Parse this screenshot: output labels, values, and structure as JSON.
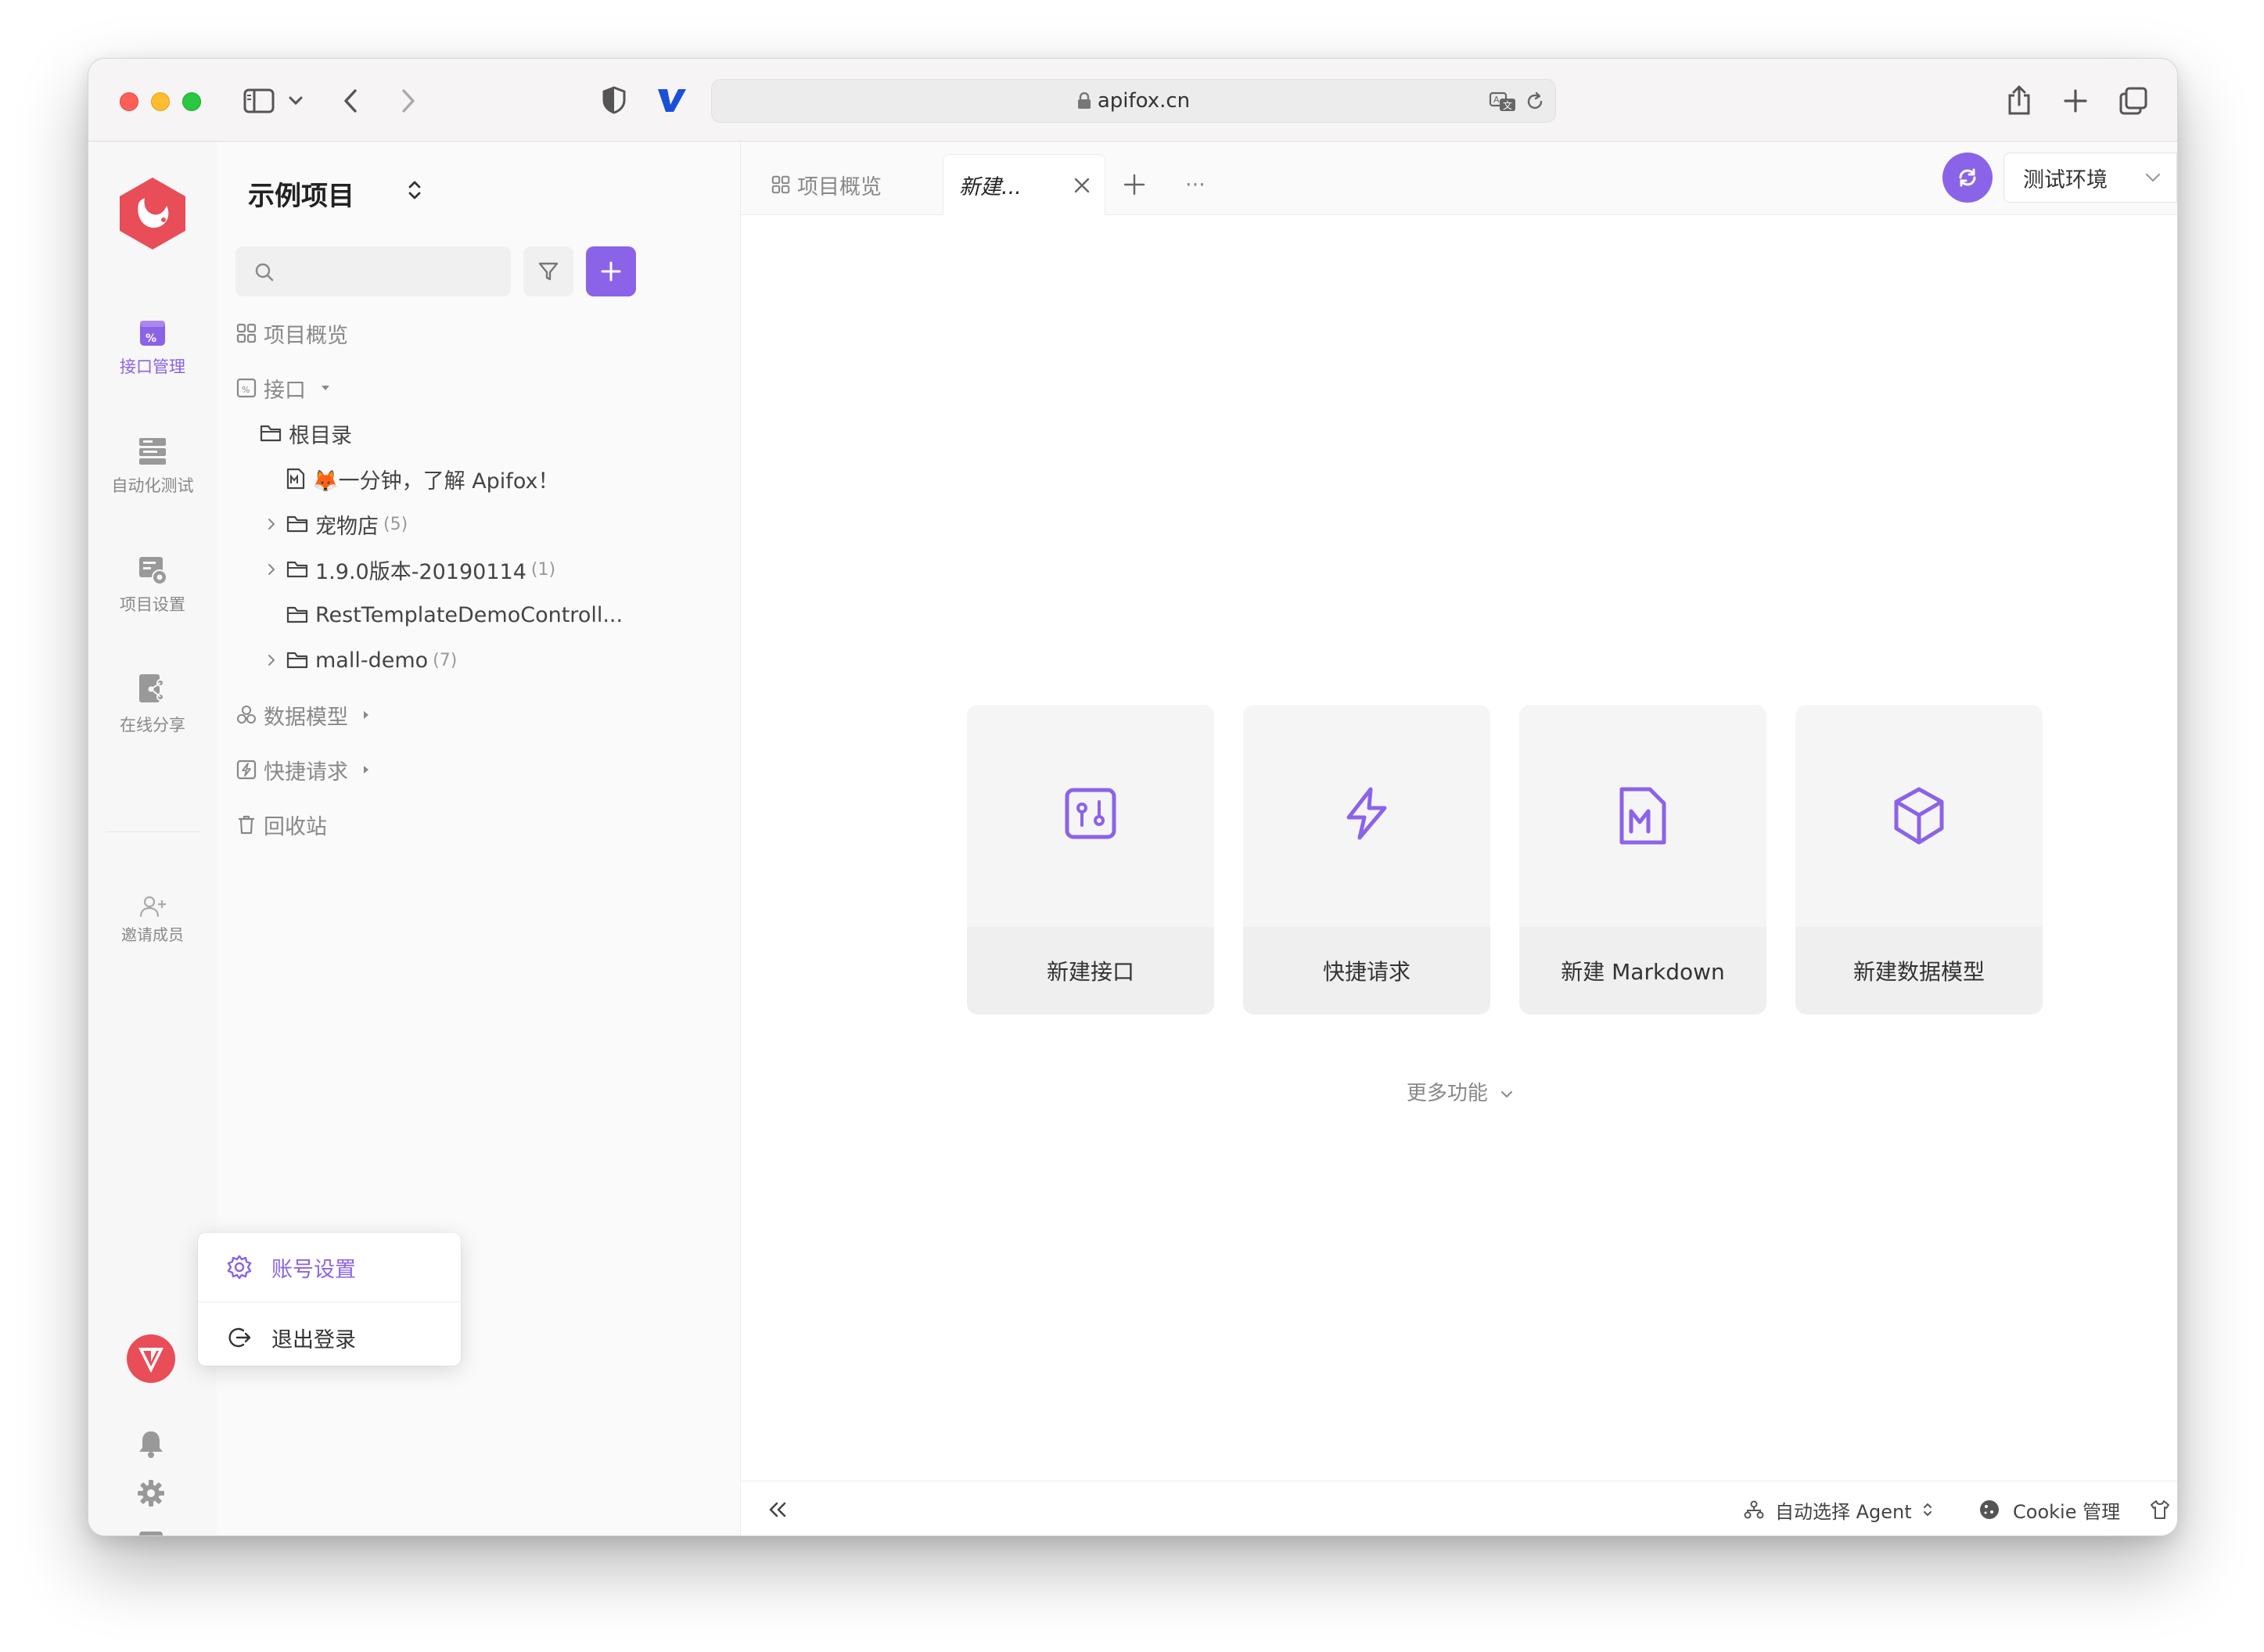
{
  "browser": {
    "url": "apifox.cn"
  },
  "rail": {
    "items": [
      {
        "label": "接口管理",
        "icon": "api-icon",
        "active": true
      },
      {
        "label": "自动化测试",
        "icon": "automation-test-icon"
      },
      {
        "label": "项目设置",
        "icon": "project-settings-icon"
      },
      {
        "label": "在线分享",
        "icon": "share-icon"
      }
    ],
    "invite_label": "邀请成员"
  },
  "sidebar": {
    "project_name": "示例项目",
    "search_placeholder": "",
    "tree": {
      "overview": "项目概览",
      "interfaces": "接口",
      "root": "根目录",
      "intro_doc": "🦊一分钟，了解 Apifox！",
      "folders": [
        {
          "name": "宠物店",
          "count": "(5)"
        },
        {
          "name": "1.9.0版本-20190114",
          "count": "(1)"
        },
        {
          "name": "RestTemplateDemoControll...",
          "count": ""
        },
        {
          "name": "mall-demo",
          "count": "(7)"
        }
      ],
      "data_models": "数据模型",
      "quick_requests": "快捷请求",
      "recycle_bin": "回收站"
    }
  },
  "tabs": {
    "overview": "项目概览",
    "new_tab": "新建...",
    "more": "···"
  },
  "env": {
    "name": "测试环境"
  },
  "cards": [
    {
      "label": "新建接口",
      "icon": "api-icon"
    },
    {
      "label": "快捷请求",
      "icon": "lightning-icon"
    },
    {
      "label": "新建 Markdown",
      "icon": "markdown-icon"
    },
    {
      "label": "新建数据模型",
      "icon": "cube-icon"
    }
  ],
  "more_features": "更多功能",
  "statusbar": {
    "agent": "自动选择 Agent",
    "cookie": "Cookie 管理"
  },
  "account_menu": {
    "settings": "账号设置",
    "logout": "退出登录"
  },
  "colors": {
    "accent": "#8b63e8",
    "logo_red": "#e84d58"
  }
}
